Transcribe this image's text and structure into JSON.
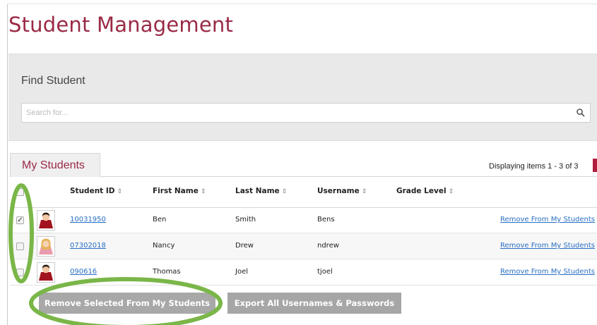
{
  "page": {
    "title": "Student Management"
  },
  "find": {
    "title": "Find Student",
    "search_placeholder": "Search for...",
    "search_value": ""
  },
  "tabs": [
    {
      "label": "My Students",
      "active": true
    }
  ],
  "paging": {
    "text": "Displaying items 1 - 3 of 3"
  },
  "grid": {
    "columns": [
      {
        "label": "Student ID",
        "sortable": true
      },
      {
        "label": "First Name",
        "sortable": true
      },
      {
        "label": "Last Name",
        "sortable": true
      },
      {
        "label": "Username",
        "sortable": true
      },
      {
        "label": "Grade Level",
        "sortable": true
      }
    ],
    "sort_glyph": "⇕",
    "select_all_checked": false,
    "rows": [
      {
        "checked": true,
        "avatar": "boy-avatar-icon",
        "student_id": "10031950",
        "first_name": "Ben",
        "last_name": "Smith",
        "username": "Bens",
        "grade_level": "",
        "action": "Remove From My Students"
      },
      {
        "checked": false,
        "avatar": "girl-avatar-icon",
        "student_id": "07302018",
        "first_name": "Nancy",
        "last_name": "Drew",
        "username": "ndrew",
        "grade_level": "",
        "action": "Remove From My Students"
      },
      {
        "checked": false,
        "avatar": "boy-avatar-icon",
        "student_id": "090616",
        "first_name": "Thomas",
        "last_name": "Joel",
        "username": "tjoel",
        "grade_level": "",
        "action": "Remove From My Students"
      }
    ]
  },
  "actions": {
    "remove_selected": "Remove Selected From My Students",
    "export_all": "Export All Usernames & Passwords"
  },
  "colors": {
    "brand": "#9a2a45",
    "link": "#2a6fc4",
    "annotation": "#7ab648",
    "button": "#a8a8a8"
  }
}
